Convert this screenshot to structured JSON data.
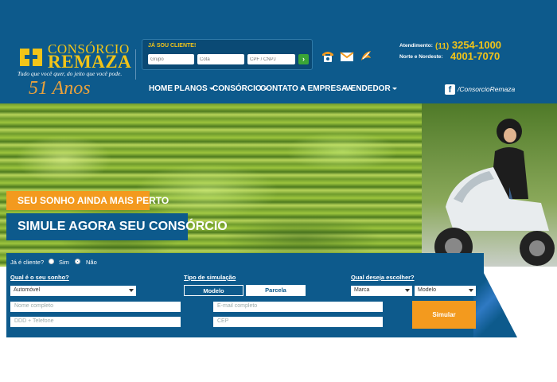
{
  "brand": {
    "name_line1": "CONSÓRCIO",
    "name_line2": "REMAZA",
    "tagline": "Tudo que você quer, do jeito que você pode.",
    "anniversary": "51 Anos",
    "colors": {
      "primary": "#0d5a8c",
      "accent": "#f39a1e",
      "gold": "#f2c418"
    }
  },
  "client_login": {
    "title": "JÁ SOU CLIENTE!",
    "group_placeholder": "Grupo",
    "cota_placeholder": "Cota",
    "cpf_placeholder": "CPF / CNPJ",
    "go_icon": "arrow-right-icon"
  },
  "header_icons": [
    "phone-icon",
    "mail-icon",
    "chat-icon"
  ],
  "contact": {
    "label1": "Atendimento:",
    "ddd1": "(11)",
    "number1": "3254-1000",
    "label2": "Norte e Nordeste:",
    "number2": "4001-7070"
  },
  "nav": {
    "items": [
      {
        "label": "HOME",
        "dropdown": false
      },
      {
        "label": "PLANOS",
        "dropdown": true
      },
      {
        "label": "CONSÓRCIO",
        "dropdown": true
      },
      {
        "label": "CONTATO",
        "dropdown": true
      },
      {
        "label": "A EMPRESA",
        "dropdown": true
      },
      {
        "label": "VENDEDOR",
        "dropdown": true
      }
    ],
    "social_icon": "facebook-icon",
    "social_text": "/ConsorcioRemaza"
  },
  "hero": {
    "banner_small": "SEU SONHO AINDA MAIS PERTO",
    "banner_large": "SIMULE AGORA SEU CONSÓRCIO"
  },
  "form": {
    "client_question": "Já é cliente?",
    "yes": "Sim",
    "no": "Não",
    "selected_client": "Não",
    "dream_label": "Qual é o seu sonho?",
    "dream_value": "Automóvel",
    "sim_type_label": "Tipo de simulação",
    "sim_options": [
      "Modelo",
      "Parcela"
    ],
    "sim_selected": "Modelo",
    "choose_label": "Qual deseja escolher?",
    "brand_value": "Marca",
    "model_value": "Modelo",
    "name_placeholder": "Nome completo",
    "email_placeholder": "E-mail completo",
    "phone_placeholder": "DDD + Telefone",
    "cep_placeholder": "CEP",
    "submit_label": "Simular"
  }
}
